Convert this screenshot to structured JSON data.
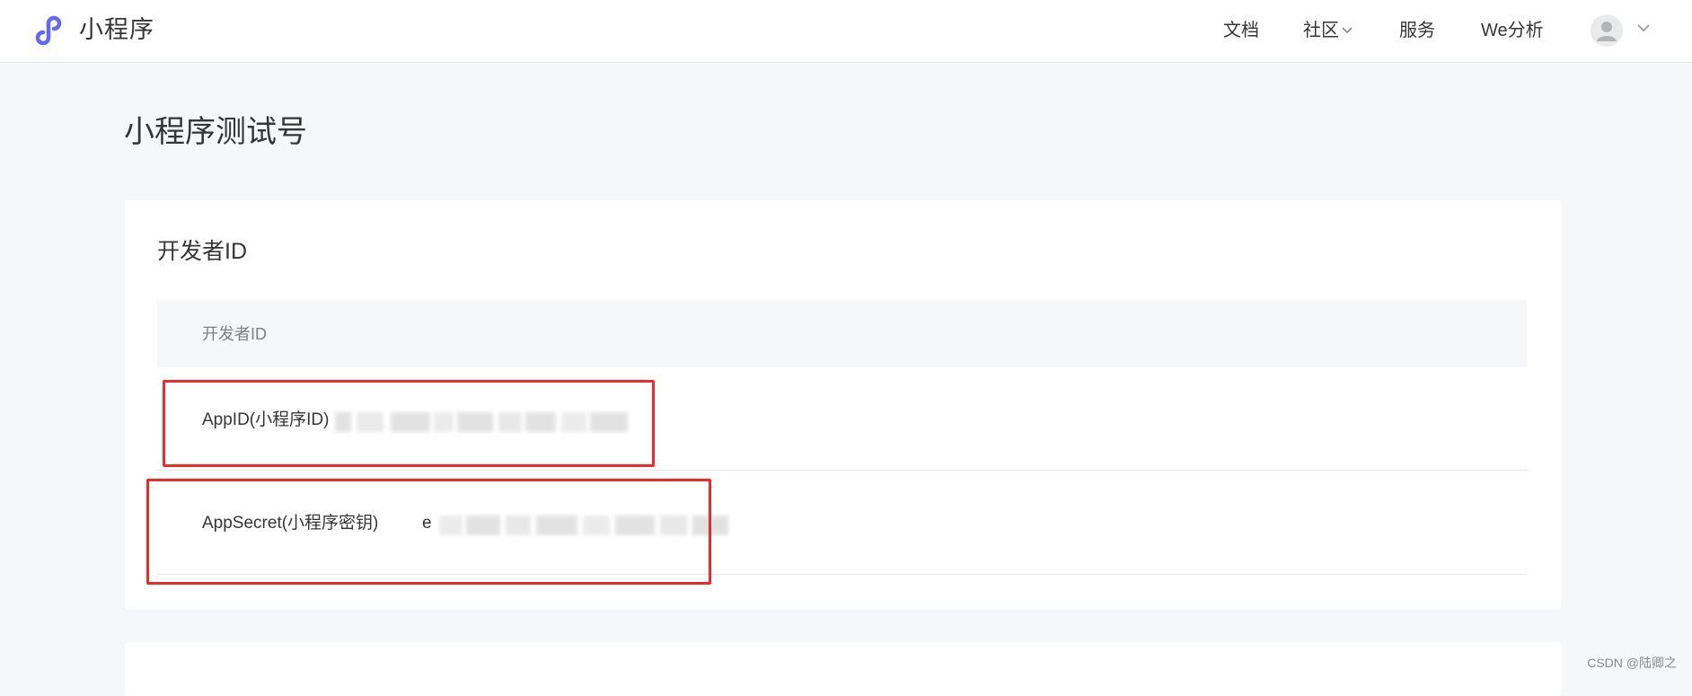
{
  "header": {
    "logo_text": "小程序",
    "nav": {
      "docs": "文档",
      "community": "社区",
      "services": "服务",
      "we_analytics": "We分析"
    }
  },
  "page": {
    "title": "小程序测试号"
  },
  "developer_card": {
    "title": "开发者ID",
    "table_header": "开发者ID",
    "rows": [
      {
        "label": "AppID(小程序ID)",
        "value": ""
      },
      {
        "label": "AppSecret(小程序密钥)",
        "value": "e"
      }
    ]
  },
  "watermark": "CSDN @陆卿之",
  "colors": {
    "brand_purple": "#6467f0",
    "annotation_red": "#ee2b2b",
    "page_bg": "#f6f7f9"
  }
}
